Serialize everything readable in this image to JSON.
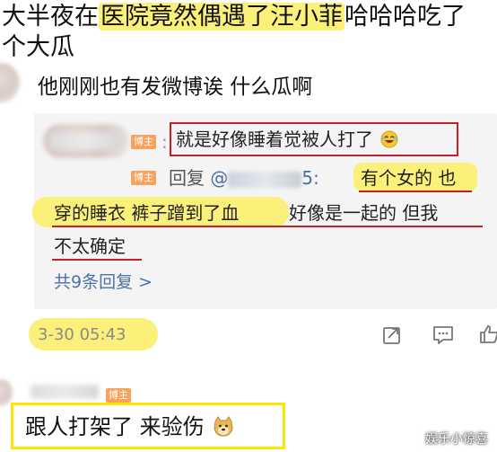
{
  "post": {
    "line1_prefix": "大半夜在",
    "line1_highlight": "医院竟然偶遇了汪小菲",
    "line1_suffix": "哈哈哈吃了",
    "line2": "个大瓜"
  },
  "comment": {
    "text": "他刚刚也有发微博诶 什么瓜啊"
  },
  "replies": [
    {
      "badge": "博主",
      "text_part1": "就是好像睡着觉被人打了"
    },
    {
      "badge": "博主",
      "prefix": "回复",
      "mention_at": "@",
      "mention_suffix": "5:",
      "text_highlight_1": "有个女的 也",
      "text_highlight_2": "穿的睡衣 裤子蹭到了血",
      "text_rest_1": " 好像是一起的 但我",
      "text_rest_2": "不太确定"
    }
  ],
  "more_replies": "共9条回复 >",
  "timestamp": "3-30 05:43",
  "bottom_comment": {
    "badge": "博主",
    "text": "跟人打架了 来验伤"
  },
  "watermark": "娱乐小惊喜",
  "colors": {
    "highlight_yellow": "#fbf07a",
    "red_mark": "#c8202a",
    "badge_orange": "#f7a35c",
    "link_blue": "#4a72ab",
    "box_yellow": "#ffe600"
  },
  "icons": [
    "share-icon",
    "comment-icon",
    "like-icon",
    "doge-emoji-icon",
    "laughing-emoji-icon"
  ]
}
